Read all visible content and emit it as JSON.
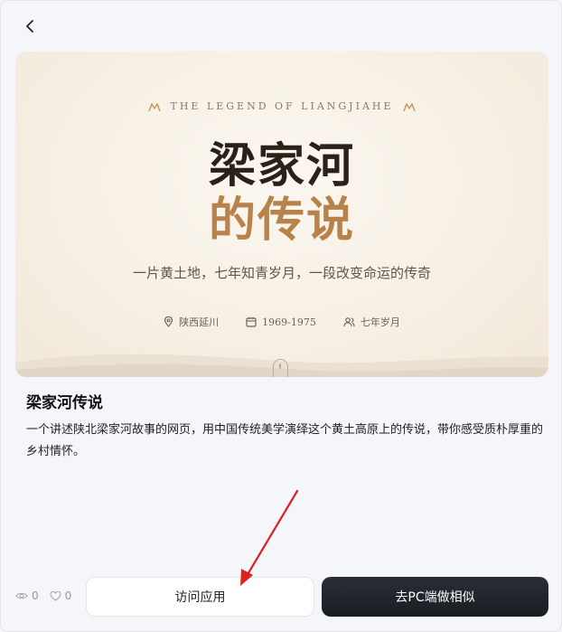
{
  "hero": {
    "eyebrow": "THE LEGEND OF LIANGJIAHE",
    "title_line1": "梁家河",
    "title_line2": "的传说",
    "subtitle": "一片黄土地，七年知青岁月，一段改变命运的传奇",
    "meta": {
      "location": "陕西延川",
      "years": "1969-1975",
      "duration": "七年岁月"
    }
  },
  "app": {
    "title": "梁家河传说",
    "description": "一个讲述陕北梁家河故事的网页，用中国传统美学演绎这个黄土高原上的传说，带你感受质朴厚重的乡村情怀。"
  },
  "stats": {
    "views": "0",
    "likes": "0"
  },
  "actions": {
    "visit_label": "访问应用",
    "similar_label": "去PC端做相似"
  },
  "colors": {
    "accent_gold": "#b8834a",
    "dark_button": "#1b1d24",
    "annotation_arrow": "#e02020"
  }
}
